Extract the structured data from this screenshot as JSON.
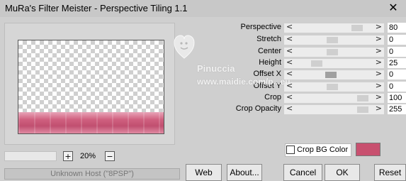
{
  "window": {
    "title": "MuRa's Filter Meister - Perspective Tiling 1.1",
    "close_glyph": "✕"
  },
  "zoom": {
    "minus": "+",
    "value": "20%",
    "plus": "−"
  },
  "host_status": "Unknown Host (\"8PSP\")",
  "params": [
    {
      "label": "Perspective",
      "value": "80"
    },
    {
      "label": "Stretch",
      "value": "0"
    },
    {
      "label": "Center",
      "value": "0"
    },
    {
      "label": "Height",
      "value": "25"
    },
    {
      "label": "Offset X",
      "value": "0"
    },
    {
      "label": "Offset Y",
      "value": "0"
    },
    {
      "label": "Crop",
      "value": "100"
    },
    {
      "label": "Crop Opacity",
      "value": "255"
    }
  ],
  "slider_arrows": {
    "left": "<",
    "right": ">"
  },
  "crop_bg": {
    "label": "Crop BG Color",
    "checked": false,
    "color": "#c8506f"
  },
  "buttons": {
    "web": "Web",
    "about": "About...",
    "cancel": "Cancel",
    "ok": "OK",
    "reset": "Reset"
  },
  "watermark": {
    "name": "Pinuccia",
    "site": "www.maidie.com/p...eu"
  },
  "colors": {
    "preview_floor": "#c8506f",
    "background": "#cfcfcf"
  }
}
